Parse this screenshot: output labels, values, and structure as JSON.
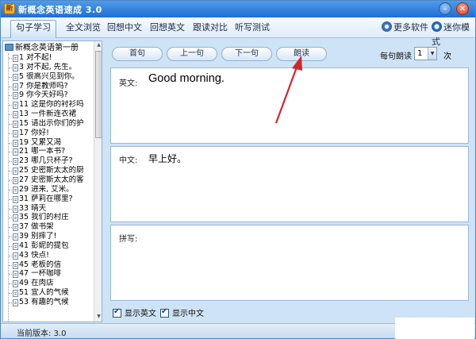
{
  "window": {
    "title": "新概念英语速成 3.0",
    "icon_label": "新"
  },
  "menu": {
    "tabs": [
      {
        "label": "句子学习"
      },
      {
        "label": "全文浏览"
      },
      {
        "label": "回想中文"
      },
      {
        "label": "回想英文"
      },
      {
        "label": "跟读对比"
      },
      {
        "label": "听写测试"
      }
    ],
    "more_software": "更多软件",
    "mini_mode": "迷你模式"
  },
  "tree": {
    "root": "新概念英语第一册",
    "items": [
      "1 对不起!",
      "3 对不起, 先生。",
      "5 很高兴见到你。",
      "7 你是教师吗?",
      "9 你今天好吗?",
      "11 这是你的衬衫吗",
      "13 一件新连衣裙",
      "15 请出示你们的护",
      "17 你好!",
      "19 又累又渴",
      "21 哪一本书?",
      "23 哪几只杯子?",
      "25 史密斯太太的厨",
      "27 史密斯太太的客",
      "29 进来, 艾米。",
      "31 萨莉在哪里?",
      "33 晴天",
      "35 我们的村庄",
      "37 做书架",
      "39 别摔了!",
      "41 彭妮的提包",
      "43 快点!",
      "45 老板的信",
      "47 一杯咖啡",
      "49 在肉店",
      "51 宜人的气候",
      "53 有趣的气候"
    ]
  },
  "toolbar": {
    "first": "首句",
    "prev": "上一句",
    "next": "下一句",
    "read": "朗读",
    "per_read_label": "每句朗读",
    "per_read_value": "1",
    "per_read_unit": "次"
  },
  "panels": {
    "english_label": "英文:",
    "english_text": "Good morning.",
    "chinese_label": "中文:",
    "chinese_text": "早上好。",
    "spelling_label": "拼写:"
  },
  "options": {
    "show_english": "显示英文",
    "show_chinese": "显示中文"
  },
  "status": {
    "version_label": "当前版本:",
    "version_value": "3.0"
  },
  "colors": {
    "annotation_arrow": "#d2262a"
  }
}
